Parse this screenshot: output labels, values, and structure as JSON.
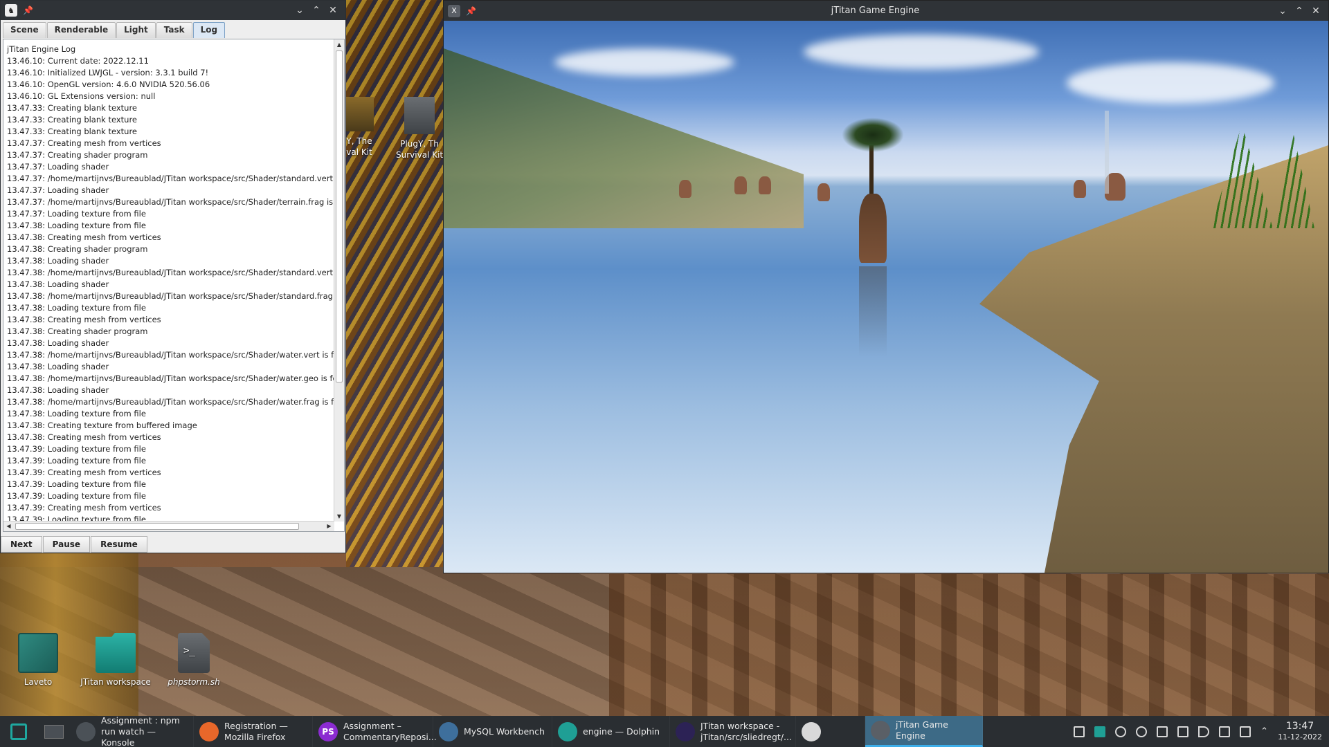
{
  "log_window": {
    "tabs": [
      "Scene",
      "Renderable",
      "Light",
      "Task",
      "Log"
    ],
    "active_tab": "Log",
    "lines": [
      "jTitan Engine Log",
      "13.46.10: Current date: 2022.12.11",
      "13.46.10: Initialized LWJGL - version: 3.3.1 build 7!",
      "13.46.10: OpenGL version: 4.6.0 NVIDIA 520.56.06",
      "13.46.10: GL Extensions version: null",
      "13.47.33: Creating blank texture",
      "13.47.33: Creating blank texture",
      "13.47.33: Creating blank texture",
      "13.47.37: Creating mesh from vertices",
      "13.47.37: Creating shader program",
      "13.47.37: Loading shader",
      "13.47.37: /home/martijnvs/Bureaublad/JTitan workspace/src/Shader/standard.vert is",
      "13.47.37: Loading shader",
      "13.47.37: /home/martijnvs/Bureaublad/JTitan workspace/src/Shader/terrain.frag is fo",
      "13.47.37: Loading texture from file",
      "13.47.38: Loading texture from file",
      "13.47.38: Creating mesh from vertices",
      "13.47.38: Creating shader program",
      "13.47.38: Loading shader",
      "13.47.38: /home/martijnvs/Bureaublad/JTitan workspace/src/Shader/standard.vert is",
      "13.47.38: Loading shader",
      "13.47.38: /home/martijnvs/Bureaublad/JTitan workspace/src/Shader/standard.frag is",
      "13.47.38: Loading texture from file",
      "13.47.38: Creating mesh from vertices",
      "13.47.38: Creating shader program",
      "13.47.38: Loading shader",
      "13.47.38: /home/martijnvs/Bureaublad/JTitan workspace/src/Shader/water.vert is fou",
      "13.47.38: Loading shader",
      "13.47.38: /home/martijnvs/Bureaublad/JTitan workspace/src/Shader/water.geo is fou",
      "13.47.38: Loading shader",
      "13.47.38: /home/martijnvs/Bureaublad/JTitan workspace/src/Shader/water.frag is fou",
      "13.47.38: Loading texture from file",
      "13.47.38: Creating texture from buffered image",
      "13.47.38: Creating mesh from vertices",
      "13.47.39: Loading texture from file",
      "13.47.39: Loading texture from file",
      "13.47.39: Creating mesh from vertices",
      "13.47.39: Loading texture from file",
      "13.47.39: Loading texture from file",
      "13.47.39: Creating mesh from vertices",
      "13.47.39: Loading texture from file"
    ],
    "buttons": {
      "next": "Next",
      "pause": "Pause",
      "resume": "Resume"
    }
  },
  "engine_window": {
    "title": "jTitan Game Engine"
  },
  "desktop": {
    "icons": [
      {
        "label": "Laveto"
      },
      {
        "label": "JTitan workspace"
      },
      {
        "label": "phpstorm.sh"
      }
    ],
    "partial_icons": [
      {
        "label": "Y, The\nval Kit"
      },
      {
        "label": "PlugY, Th\nSurvival Kit"
      }
    ],
    "script_glyph": ">_"
  },
  "taskbar": {
    "tasks": [
      {
        "line1": "Assignment : npm",
        "line2": "run watch — Konsole",
        "icon": "terminal-icon",
        "color": "#4b5157"
      },
      {
        "line1": "Registration —",
        "line2": "Mozilla Firefox",
        "icon": "firefox-icon",
        "color": "#e8672a"
      },
      {
        "line1": "Assignment –",
        "line2": "CommentaryReposi...",
        "icon": "phpstorm-icon",
        "color": "#8b2bd1",
        "glyph": "PS"
      },
      {
        "line1": "MySQL Workbench",
        "line2": "",
        "icon": "mysql-workbench-icon",
        "color": "#3e6f9c"
      },
      {
        "line1": "engine — Dolphin",
        "line2": "",
        "icon": "dolphin-folder-icon",
        "color": "#1f9f95"
      },
      {
        "line1": "JTitan workspace -",
        "line2": "jTitan/src/sliedregt/...",
        "icon": "eclipse-icon",
        "color": "#2c2255"
      },
      {
        "line1": "",
        "line2": "",
        "icon": "java-app-icon",
        "color": "#d9d9d9"
      },
      {
        "line1": "jTitan Game Engine",
        "line2": "",
        "icon": "x-window-icon",
        "color": "#5a5f66",
        "active": true
      }
    ],
    "clock": {
      "time": "13:47",
      "date": "11-12-2022"
    }
  },
  "colors": {
    "titlebar": "#2f3337",
    "taskbar": "#2a2e32",
    "active_task": "#3d6a86",
    "accent": "#3daee9"
  }
}
